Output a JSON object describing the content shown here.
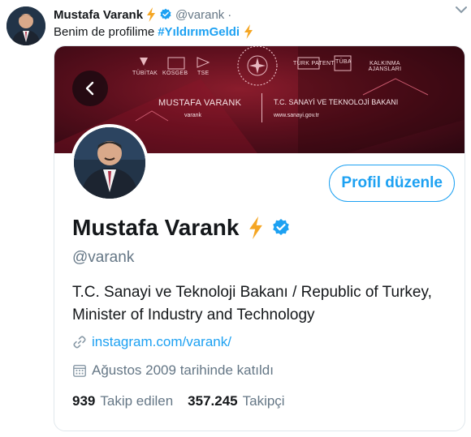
{
  "tweet": {
    "author_name": "Mustafa Varank",
    "author_handle": "@varank",
    "separator": "·",
    "text": "Benim de profilime",
    "hashtag": "#YıldırımGeldi"
  },
  "profile_card": {
    "banner": {
      "logos": [
        "TÜBİTAK",
        "KOSGEB",
        "TSE",
        "TÜRK PATENT",
        "TÜBA",
        "KALKINMA AJANSLARI"
      ],
      "name": "MUSTAFA VARANK",
      "title": "T.C. SANAYİ VE TEKNOLOJİ BAKANI",
      "social_handle": "varank",
      "website": "www.sanayi.gov.tr"
    },
    "edit_button_label": "Profil düzenle",
    "name": "Mustafa Varank",
    "handle": "@varank",
    "bio": "T.C. Sanayi ve Teknoloji Bakanı / Republic of Turkey, Minister of Industry and Technology",
    "link": "instagram.com/varank/",
    "joined": "Ağustos 2009 tarihinde katıldı",
    "following_count": "939",
    "following_label": "Takip edilen",
    "followers_count": "357.245",
    "followers_label": "Takipçi"
  },
  "colors": {
    "accent": "#1da1f2",
    "bolt": "#f5a623",
    "muted": "#657786",
    "banner": "#6b1120"
  },
  "icons": [
    "lightning-bolt-icon",
    "verified-badge-icon",
    "chevron-down-icon",
    "back-arrow-icon",
    "link-icon",
    "calendar-icon"
  ]
}
